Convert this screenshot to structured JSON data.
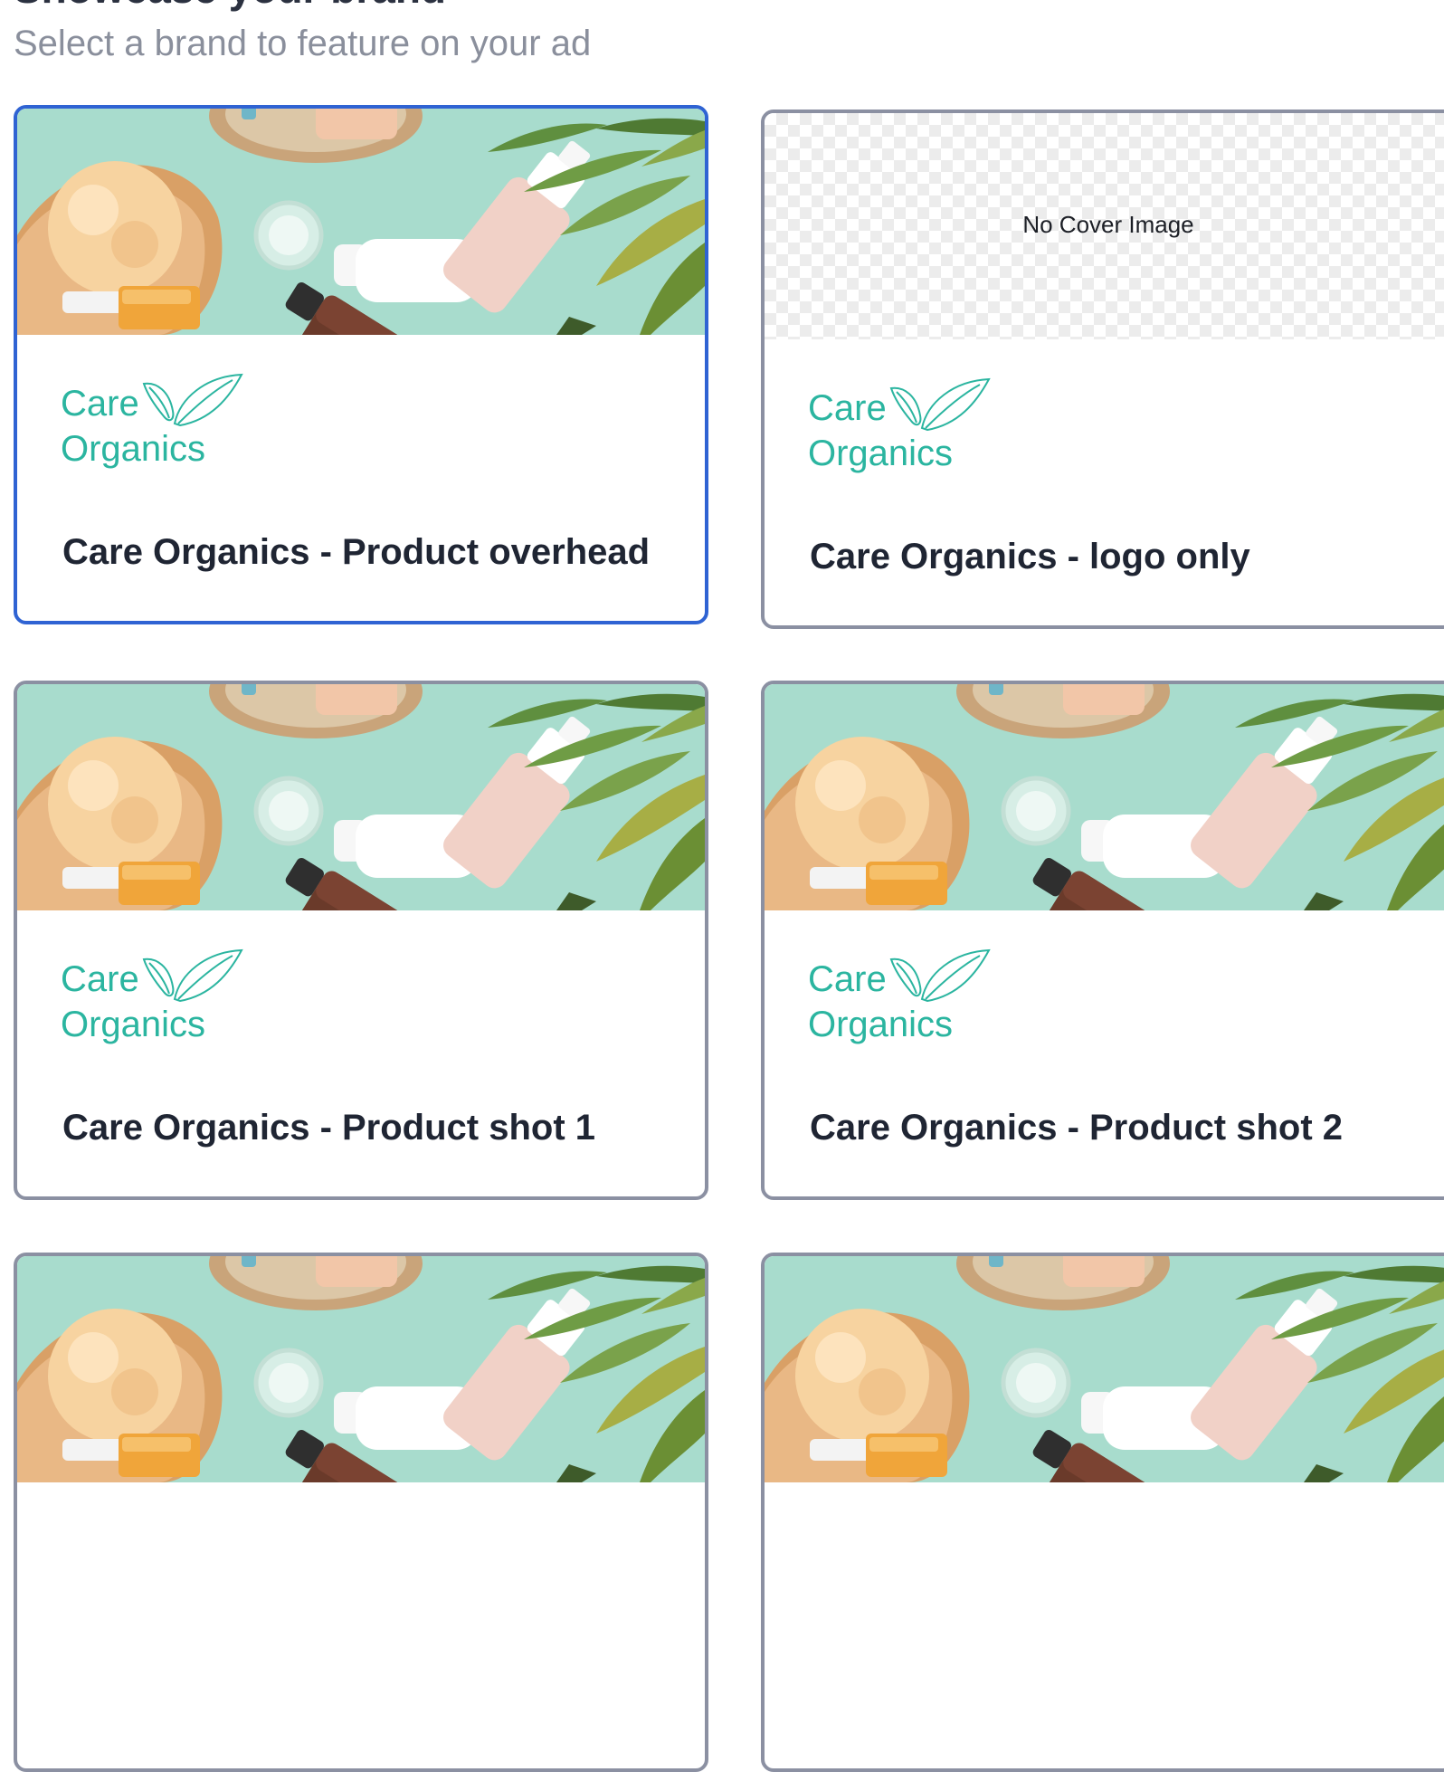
{
  "header": {
    "title": "Showcase your brand",
    "subtitle": "Select a brand to feature on your ad"
  },
  "logo": {
    "line1": "Care",
    "line2": "Organics"
  },
  "colors": {
    "selected_border": "#2f63d3",
    "card_border": "#8b90a2",
    "logo_teal": "#2bb5a0",
    "cover_background": "#a8dccd"
  },
  "cards": [
    {
      "name": "Care Organics - Product overhead",
      "cover_text": "",
      "selected": true
    },
    {
      "name": "Care Organics - logo only",
      "cover_text": "No Cover Image",
      "selected": false
    },
    {
      "name": "Care Organics - Product shot 1",
      "cover_text": "",
      "selected": false
    },
    {
      "name": "Care Organics - Product shot 2",
      "cover_text": "",
      "selected": false
    },
    {
      "name": "",
      "cover_text": "",
      "selected": false
    },
    {
      "name": "",
      "cover_text": "",
      "selected": false
    }
  ]
}
